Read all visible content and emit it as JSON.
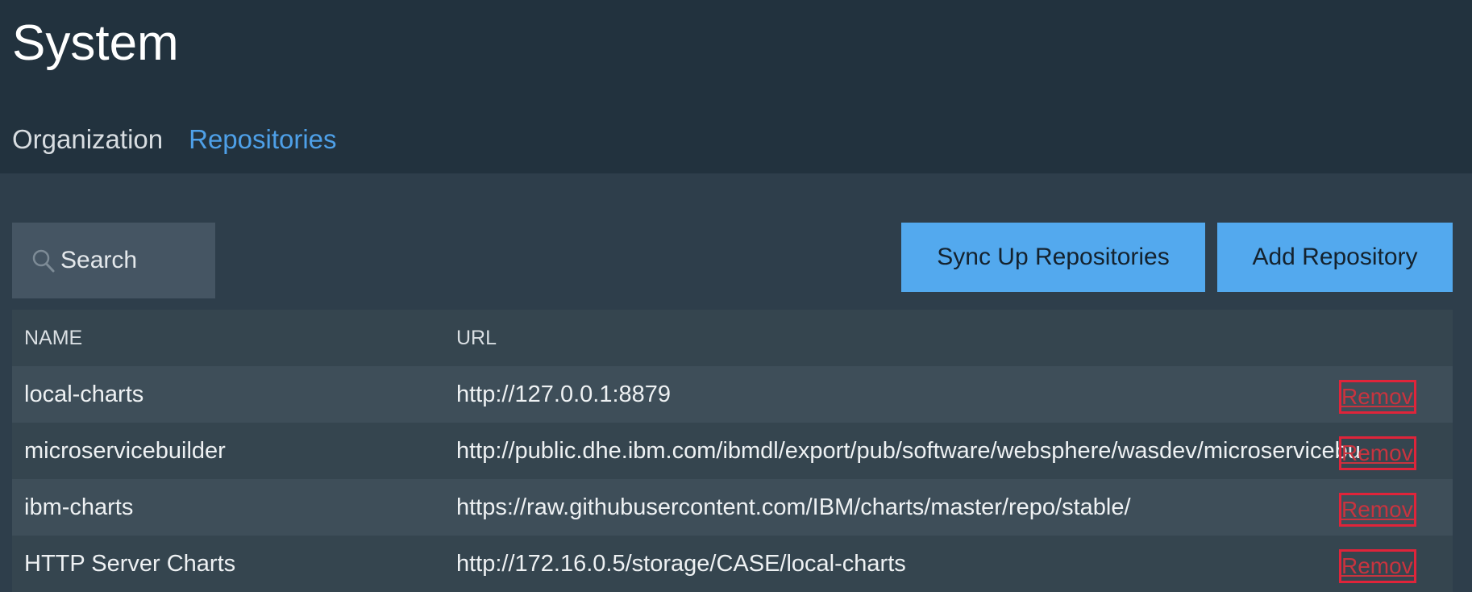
{
  "page": {
    "title": "System"
  },
  "tabs": [
    {
      "label": "Organization",
      "active": false
    },
    {
      "label": "Repositories",
      "active": true
    }
  ],
  "toolbar": {
    "search_placeholder": "Search",
    "sync_label": "Sync Up Repositories",
    "add_label": "Add Repository"
  },
  "table": {
    "columns": [
      "NAME",
      "URL"
    ],
    "rows": [
      {
        "name": "local-charts",
        "url": "http://127.0.0.1:8879",
        "action": "Remove"
      },
      {
        "name": "microservicebuilder",
        "url": "http://public.dhe.ibm.com/ibmdl/export/pub/software/websphere/wasdev/microservicebu",
        "action": "Remove"
      },
      {
        "name": "ibm-charts",
        "url": "https://raw.githubusercontent.com/IBM/charts/master/repo/stable/",
        "action": "Remove"
      },
      {
        "name": "HTTP Server Charts",
        "url": "http://172.16.0.5/storage/CASE/local-charts",
        "action": "Remove"
      }
    ]
  },
  "colors": {
    "header_bg": "#22323e",
    "body_bg": "#2e3e4b",
    "accent": "#4ea0e8",
    "button_bg": "#53a9ee",
    "remove_highlight": "#e0243a"
  },
  "icons": {
    "search": "search-icon"
  }
}
